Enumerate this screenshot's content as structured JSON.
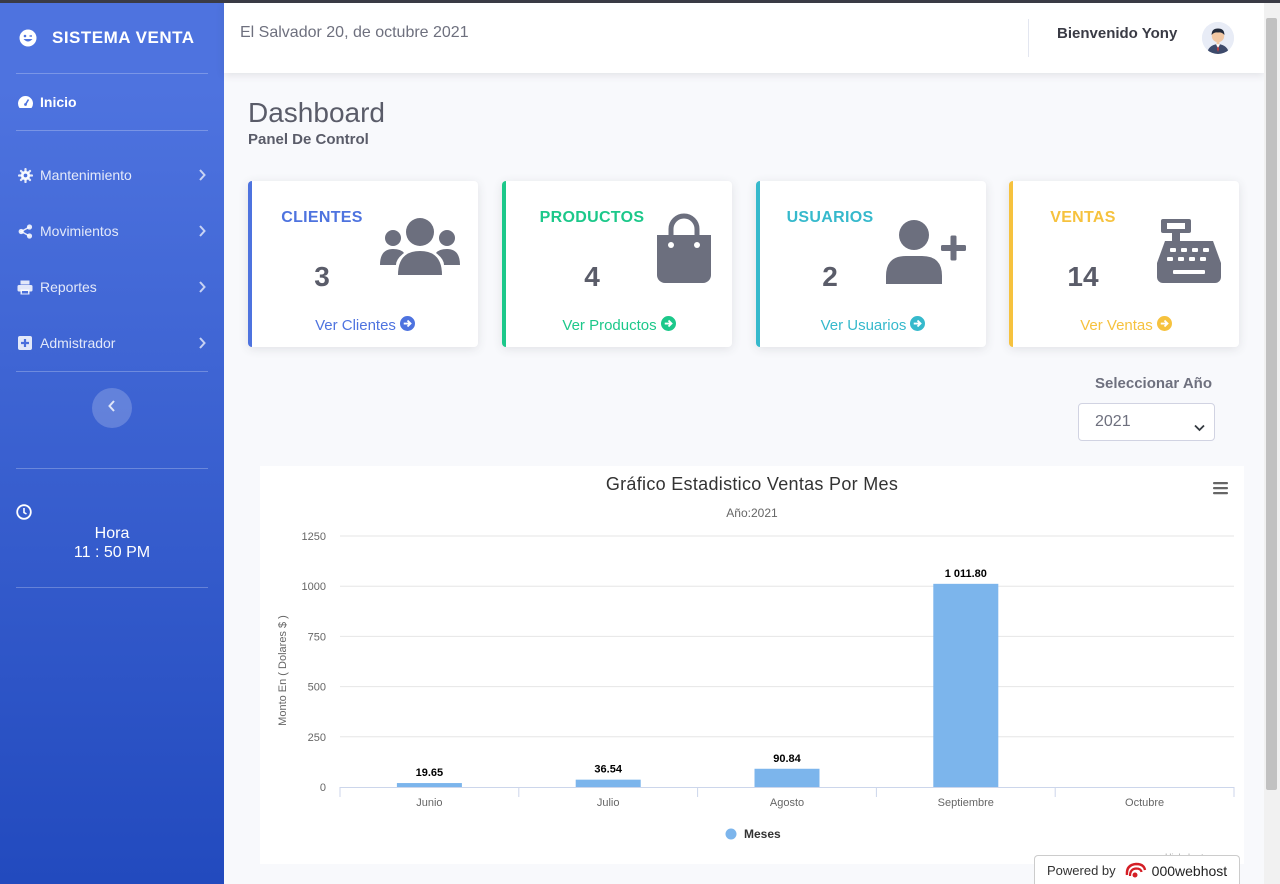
{
  "sidebar": {
    "brand": "SISTEMA VENTA",
    "items": [
      {
        "label": "Inicio",
        "icon": "tachometer-icon"
      },
      {
        "label": "Mantenimiento",
        "icon": "gear-icon"
      },
      {
        "label": "Movimientos",
        "icon": "share-icon"
      },
      {
        "label": "Reportes",
        "icon": "print-icon"
      },
      {
        "label": "Admistrador",
        "icon": "plus-square-icon"
      }
    ],
    "hora_label": "Hora",
    "time": "11 : 50 PM"
  },
  "topbar": {
    "date": "El Salvador 20, de octubre 2021",
    "welcome": "Bienvenido Yony"
  },
  "page": {
    "title": "Dashboard",
    "subtitle": "Panel De Control"
  },
  "cards": [
    {
      "title": "CLIENTES",
      "value": "3",
      "link": "Ver Clientes",
      "color": "#4e73df",
      "icon": "users-icon"
    },
    {
      "title": "PRODUCTOS",
      "value": "4",
      "link": "Ver Productos",
      "color": "#1cc88a",
      "icon": "shopping-bag-icon"
    },
    {
      "title": "USUARIOS",
      "value": "2",
      "link": "Ver Usuarios",
      "color": "#36b9cc",
      "icon": "user-plus-icon"
    },
    {
      "title": "VENTAS",
      "value": "14",
      "link": "Ver Ventas",
      "color": "#f6c23e",
      "icon": "cash-register-icon"
    }
  ],
  "year_select": {
    "label": "Seleccionar Año",
    "value": "2021"
  },
  "chart_data": {
    "type": "bar",
    "title": "Gráfico Estadistico Ventas Por Mes",
    "subtitle": "Año:2021",
    "ylabel": "Monto En ( Dolares $ )",
    "xlabel": "",
    "categories": [
      "Junio",
      "Julio",
      "Agosto",
      "Septiembre",
      "Octubre"
    ],
    "series": [
      {
        "name": "Meses",
        "values": [
          19.65,
          36.54,
          90.84,
          1011.8
        ],
        "data_labels": [
          "19.65",
          "36.54",
          "90.84",
          "1 011.80"
        ],
        "color": "#7cb5ec"
      }
    ],
    "ylim": [
      0,
      1250
    ],
    "yticks": [
      0,
      250,
      500,
      750,
      1000,
      1250
    ],
    "grid": true,
    "legend": "bottom-center",
    "credit": "Highcharts.com"
  },
  "powered": {
    "prefix": "Powered by",
    "name": "000webhost"
  }
}
